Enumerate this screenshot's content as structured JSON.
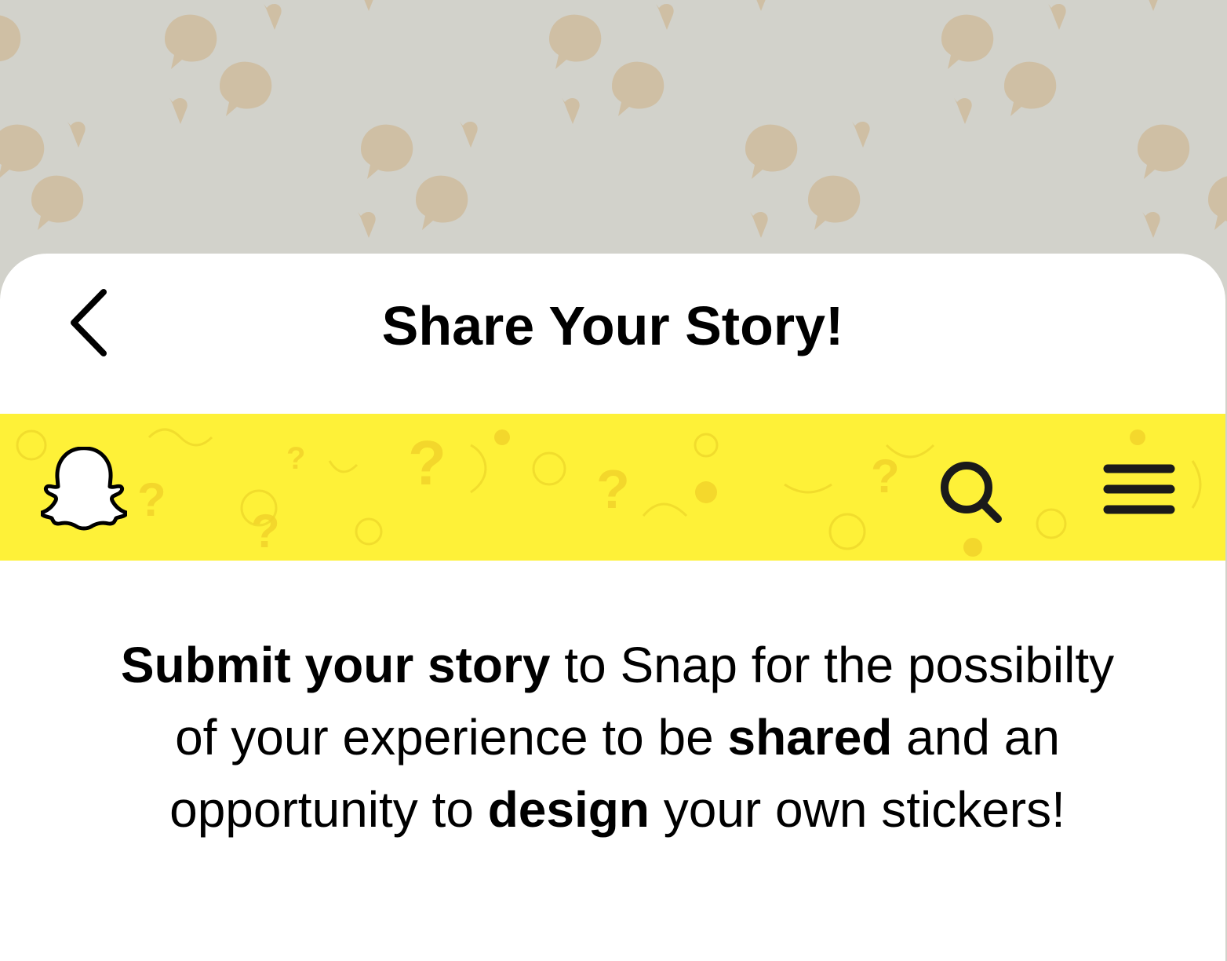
{
  "colors": {
    "background": "#d2d2cb",
    "pattern_shape": "#cfbfa4",
    "sheet": "#ffffff",
    "brand_yellow": "#fef138",
    "text": "#000000"
  },
  "header": {
    "back_icon": "chevron-left-icon",
    "title": "Share Your Story!"
  },
  "snap_bar": {
    "logo_icon": "snapchat-ghost-icon",
    "search_icon": "search-icon",
    "menu_icon": "hamburger-menu-icon"
  },
  "description": {
    "part1_bold": "Submit your story",
    "part2": " to Snap for the possibilty of your experience to be ",
    "part3_bold": "shared",
    "part4": " and an opportunity to ",
    "part5_bold": "design",
    "part6": " your own stickers!"
  }
}
